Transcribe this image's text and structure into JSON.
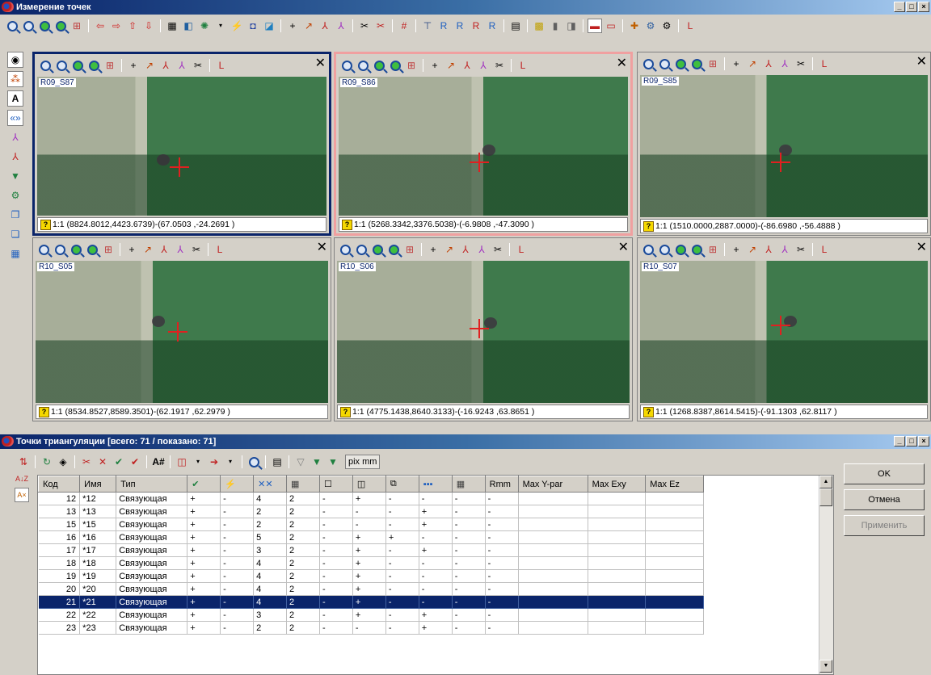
{
  "main_window": {
    "title": "Измерение точек",
    "win_buttons": [
      "_",
      "□",
      "×"
    ]
  },
  "viewports": [
    {
      "name": "R09_S87",
      "status": "1:1 (8824.8012,4423.6739)-(67.0503 ,-24.2691 )",
      "selected": "blue"
    },
    {
      "name": "R09_S86",
      "status": "1:1 (5268.3342,3376.5038)-(-6.9808 ,-47.3090 )",
      "selected": "red"
    },
    {
      "name": "R09_S85",
      "status": "1:1 (1510.0000,2887.0000)-(-86.6980 ,-56.4888 )",
      "selected": "none"
    },
    {
      "name": "R10_S05",
      "status": "1:1 (8534.8527,8589.3501)-(62.1917 ,62.2979 )",
      "selected": "none"
    },
    {
      "name": "R10_S06",
      "status": "1:1 (4775.1438,8640.3133)-(-16.9243 ,63.8651 )",
      "selected": "none"
    },
    {
      "name": "R10_S07",
      "status": "1:1 (1268.8387,8614.5415)-(-91.1303 ,62.8117 )",
      "selected": "none"
    }
  ],
  "points_window": {
    "title": "Точки триангуляции [всего: 71 / показано: 71]",
    "toolbar_units": "pix mm",
    "columns": [
      "Код",
      "Имя",
      "Тип",
      "✔",
      "⚡",
      "✕✕",
      "▦",
      "☐",
      "◫",
      "⧉",
      "▪▪▪",
      "▦",
      "Rmm",
      "Max Y-par",
      "Max Exy",
      "Max Ez"
    ],
    "rows": [
      [
        "12",
        "*12",
        "Связующая",
        "+",
        "-",
        "4",
        "2",
        "-",
        "+",
        "-",
        "-",
        "-",
        "-",
        "",
        "",
        ""
      ],
      [
        "13",
        "*13",
        "Связующая",
        "+",
        "-",
        "2",
        "2",
        "-",
        "-",
        "-",
        "+",
        "-",
        "-",
        "",
        "",
        ""
      ],
      [
        "15",
        "*15",
        "Связующая",
        "+",
        "-",
        "2",
        "2",
        "-",
        "-",
        "-",
        "+",
        "-",
        "-",
        "",
        "",
        ""
      ],
      [
        "16",
        "*16",
        "Связующая",
        "+",
        "-",
        "5",
        "2",
        "-",
        "+",
        "+",
        "-",
        "-",
        "-",
        "",
        "",
        ""
      ],
      [
        "17",
        "*17",
        "Связующая",
        "+",
        "-",
        "3",
        "2",
        "-",
        "+",
        "-",
        "+",
        "-",
        "-",
        "",
        "",
        ""
      ],
      [
        "18",
        "*18",
        "Связующая",
        "+",
        "-",
        "4",
        "2",
        "-",
        "+",
        "-",
        "-",
        "-",
        "-",
        "",
        "",
        ""
      ],
      [
        "19",
        "*19",
        "Связующая",
        "+",
        "-",
        "4",
        "2",
        "-",
        "+",
        "-",
        "-",
        "-",
        "-",
        "",
        "",
        ""
      ],
      [
        "20",
        "*20",
        "Связующая",
        "+",
        "-",
        "4",
        "2",
        "-",
        "+",
        "-",
        "-",
        "-",
        "-",
        "",
        "",
        ""
      ],
      [
        "21",
        "*21",
        "Связующая",
        "+",
        "-",
        "4",
        "2",
        "-",
        "+",
        "-",
        "-",
        "-",
        "-",
        "",
        "",
        ""
      ],
      [
        "22",
        "*22",
        "Связующая",
        "+",
        "-",
        "3",
        "2",
        "-",
        "+",
        "-",
        "+",
        "-",
        "-",
        "",
        "",
        ""
      ],
      [
        "23",
        "*23",
        "Связующая",
        "+",
        "-",
        "2",
        "2",
        "-",
        "-",
        "-",
        "+",
        "-",
        "-",
        "",
        "",
        ""
      ]
    ],
    "selected_row": 8,
    "buttons": {
      "ok": "OK",
      "cancel": "Отмена",
      "apply": "Применить"
    }
  },
  "colors": {
    "selection": "#0a246a",
    "crosshair": "#e02020",
    "field_green": "#3f7a4c",
    "field_light": "#a7ae99"
  }
}
